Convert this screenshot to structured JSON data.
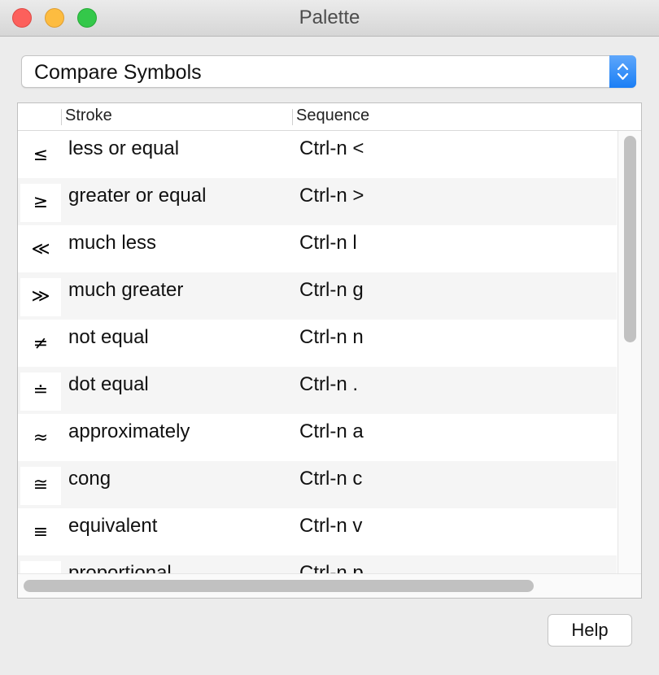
{
  "window": {
    "title": "Palette"
  },
  "popup": {
    "selected": "Compare Symbols"
  },
  "table": {
    "columns": [
      "Stroke",
      "Sequence"
    ],
    "rows": [
      {
        "symbol": "≤",
        "stroke": "less or equal",
        "sequence": "Ctrl-n <"
      },
      {
        "symbol": "≥",
        "stroke": "greater or equal",
        "sequence": "Ctrl-n >"
      },
      {
        "symbol": "≪",
        "stroke": "much less",
        "sequence": "Ctrl-n l"
      },
      {
        "symbol": "≫",
        "stroke": "much greater",
        "sequence": "Ctrl-n g"
      },
      {
        "symbol": "≠",
        "stroke": "not equal",
        "sequence": "Ctrl-n n"
      },
      {
        "symbol": "≐",
        "stroke": "dot equal",
        "sequence": "Ctrl-n ."
      },
      {
        "symbol": "≈",
        "stroke": "approximately",
        "sequence": "Ctrl-n a"
      },
      {
        "symbol": "≅",
        "stroke": "cong",
        "sequence": "Ctrl-n c"
      },
      {
        "symbol": "≡",
        "stroke": "equivalent",
        "sequence": "Ctrl-n v"
      },
      {
        "symbol": "∝",
        "stroke": "proportional",
        "sequence": "Ctrl-n p"
      }
    ]
  },
  "buttons": {
    "help": "Help"
  },
  "colors": {
    "accent": "#1a7ef5",
    "close": "#fc605c",
    "minimize": "#fdbc40",
    "maximize": "#34c84a"
  },
  "icons": {
    "popup": "up-down-chevron-icon"
  }
}
